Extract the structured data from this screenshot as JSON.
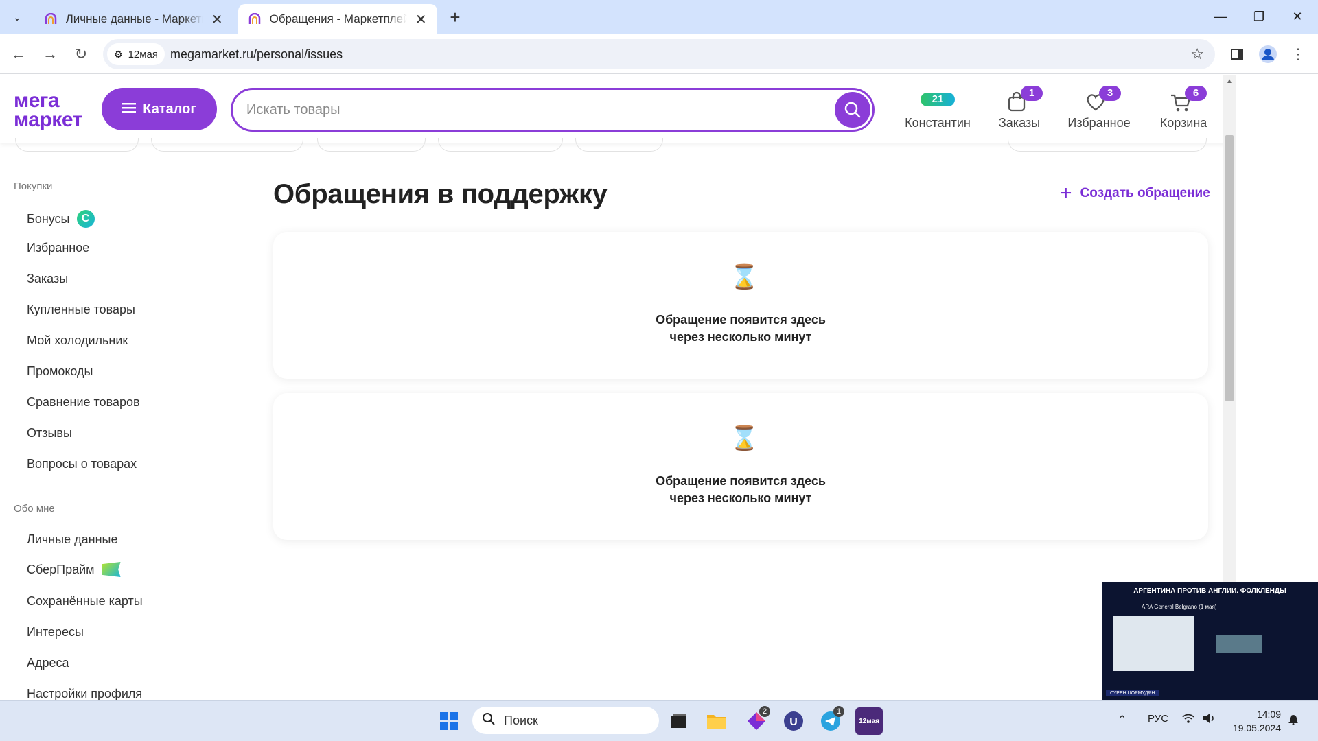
{
  "browser": {
    "tabs": [
      {
        "title": "Личные данные - Маркетплейс megamarket.ru",
        "active": false
      },
      {
        "title": "Обращения - Маркетплейс megamarket.ru",
        "active": true
      }
    ],
    "site_chip": "12мая",
    "url": "megamarket.ru/personal/issues"
  },
  "header": {
    "logo_line1": "мега",
    "logo_line2": "маркет",
    "catalog_label": "Каталог",
    "search_placeholder": "Искать товары",
    "profile": {
      "label": "Константин",
      "bonus": "21"
    },
    "orders": {
      "label": "Заказы",
      "count": "1"
    },
    "favorites": {
      "label": "Избранное",
      "count": "3"
    },
    "cart": {
      "label": "Корзина",
      "count": "6"
    }
  },
  "sidebar": {
    "section1_title": "Покупки",
    "section1_items": [
      "Бонусы",
      "Избранное",
      "Заказы",
      "Купленные товары",
      "Мой холодильник",
      "Промокоды",
      "Сравнение товаров",
      "Отзывы",
      "Вопросы о товарах"
    ],
    "section2_title": "Обо мне",
    "section2_items": [
      "Личные данные",
      "СберПрайм",
      "Сохранённые карты",
      "Интересы",
      "Адреса",
      "Настройки профиля"
    ]
  },
  "main": {
    "title": "Обращения в поддержку",
    "create_label": "Создать обращение",
    "cards": [
      {
        "line1": "Обращение появится здесь",
        "line2": "через несколько минут"
      },
      {
        "line1": "Обращение появится здесь",
        "line2": "через несколько минут"
      }
    ]
  },
  "pip": {
    "title": "АРГЕНТИНА ПРОТИВ АНГЛИИ. ФОЛКЛЕНДЫ",
    "subtitle": "ARA General Belgrano (1 мая)",
    "name": "СУРЕН ЦОРМУДЯН"
  },
  "taskbar": {
    "search_label": "Поиск",
    "app_badges": {
      "app1": "2",
      "telegram": "1"
    },
    "app_tile": "12мая",
    "lang": "РУС",
    "time": "14:09",
    "date": "19.05.2024"
  },
  "colors": {
    "accent": "#8b3dd8",
    "brand": "#7b2ed6",
    "tabstrip": "#d3e3fd"
  }
}
